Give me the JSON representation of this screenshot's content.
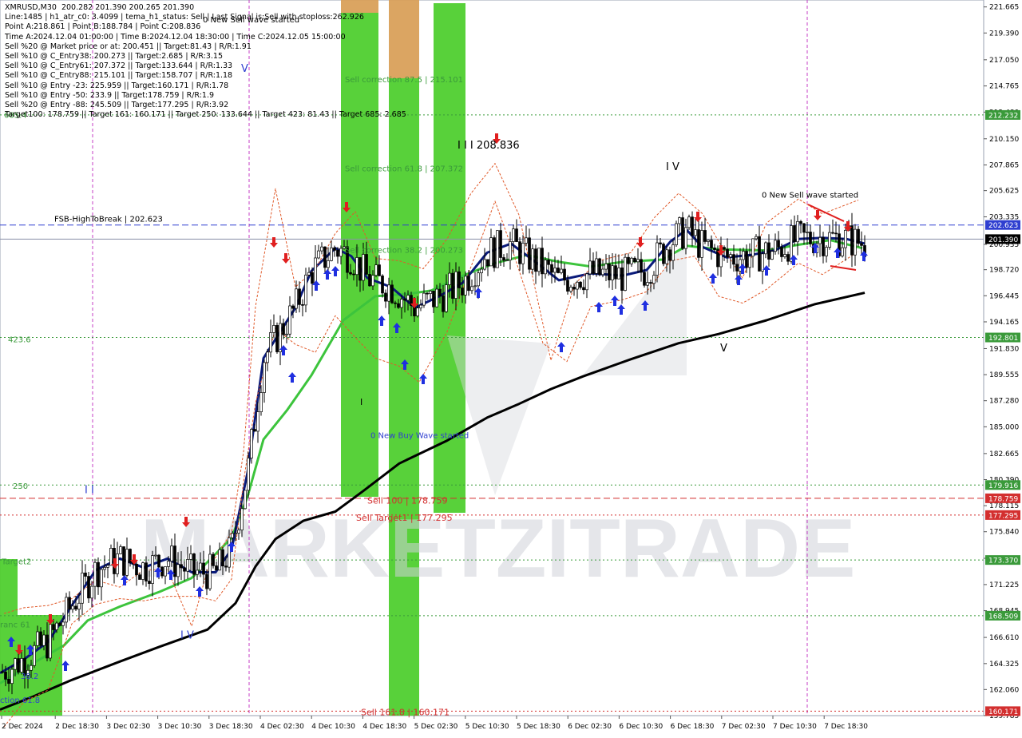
{
  "info_lines": [
    "XMRUSD,M30  200.282 201.390 200.265 201.390",
    "Line:1485 | h1_atr_c0: 3.4099 | tema_h1_status: Sell | Last Signal is:Sell with stoploss:262.926",
    "Point A:218.861 | Point B:188.784 | Point C:208.836",
    "Time A:2024.12.04 01:00:00 | Time B:2024.12.04 18:30:00 | Time C:2024.12.05 15:00:00",
    "Sell %20 @ Market price or at: 200.451 || Target:81.43 | R/R:1.91",
    "Sell %10 @ C_Entry38: 200.273 || Target:2.685 | R/R:3.15",
    "Sell %10 @ C_Entry61: 207.372 || Target:133.644 | R/R:1.33",
    "Sell %10 @ C_Entry88: 215.101 || Target:158.707 | R/R:1.18",
    "Sell %10 @ Entry -23: 225.959 || Target:160.171 | R/R:1.78",
    "Sell %10 @ Entry -50: 233.9 || Target:178.759 | R/R:1.9",
    "Sell %20 @ Entry -88: 245.509 || Target:177.295 | R/R:3.92",
    "Target100: 178.759 || Target 161: 160.171 || Target 250: 133.644 || Target 423: 81.43 || Target 685: 2.685"
  ],
  "watermark": "MARKETZITRADE",
  "chart_data": {
    "type": "candlestick",
    "symbol": "XMRUSD",
    "timeframe": "M30",
    "ylim": [
      159.78,
      222.27
    ],
    "y_ticks": [
      "221.665",
      "219.390",
      "217.050",
      "214.765",
      "212.480",
      "210.150",
      "207.865",
      "205.625",
      "203.335",
      "200.935",
      "198.720",
      "196.445",
      "194.165",
      "191.830",
      "189.555",
      "187.280",
      "185.000",
      "182.665",
      "180.390",
      "178.115",
      "175.840",
      "173.520",
      "171.225",
      "168.945",
      "166.610",
      "164.325",
      "162.060",
      "159.785"
    ],
    "x_ticks": [
      "2 Dec 2024",
      "2 Dec 18:30",
      "3 Dec 02:30",
      "3 Dec 10:30",
      "3 Dec 18:30",
      "4 Dec 02:30",
      "4 Dec 10:30",
      "4 Dec 18:30",
      "5 Dec 02:30",
      "5 Dec 10:30",
      "5 Dec 18:30",
      "6 Dec 02:30",
      "6 Dec 10:30",
      "6 Dec 18:30",
      "7 Dec 02:30",
      "7 Dec 10:30",
      "7 Dec 18:30"
    ],
    "price_labels": [
      {
        "value": 212.232,
        "text": "212.232",
        "color": "#3a9a3a"
      },
      {
        "value": 202.623,
        "text": "202.623",
        "color": "#2f3fd0"
      },
      {
        "value": 201.39,
        "text": "201.390",
        "color": "#000000"
      },
      {
        "value": 192.801,
        "text": "192.801",
        "color": "#3a9a3a"
      },
      {
        "value": 179.916,
        "text": "179.916",
        "color": "#3a9a3a"
      },
      {
        "value": 178.759,
        "text": "178.759",
        "color": "#d32f2f"
      },
      {
        "value": 177.295,
        "text": "177.295",
        "color": "#d32f2f"
      },
      {
        "value": 173.37,
        "text": "173.370",
        "color": "#3a9a3a"
      },
      {
        "value": 168.509,
        "text": "168.509",
        "color": "#3a9a3a"
      },
      {
        "value": 160.171,
        "text": "160.171",
        "color": "#d32f2f"
      }
    ],
    "h_lines": [
      {
        "value": 212.232,
        "color": "#3a9a3a",
        "style": "dotted"
      },
      {
        "value": 202.623,
        "color": "#2f3fd0",
        "style": "dashed"
      },
      {
        "value": 201.39,
        "color": "#8a8fa8",
        "style": "solid"
      },
      {
        "value": 192.801,
        "color": "#3a9a3a",
        "style": "dotted"
      },
      {
        "value": 179.916,
        "color": "#3a9a3a",
        "style": "dotted"
      },
      {
        "value": 178.759,
        "color": "#d32f2f",
        "style": "dashed"
      },
      {
        "value": 177.295,
        "color": "#d32f2f",
        "style": "dotted"
      },
      {
        "value": 173.37,
        "color": "#3a9a3a",
        "style": "dotted"
      },
      {
        "value": 168.509,
        "color": "#3a9a3a",
        "style": "dotted"
      },
      {
        "value": 160.171,
        "color": "#d32f2f",
        "style": "dotted"
      }
    ],
    "level_labels": [
      {
        "text": "685.4",
        "value": 212.0,
        "x": 5,
        "color": "#3a9a3a"
      },
      {
        "text": "423.6",
        "value": 192.4,
        "x": 10,
        "color": "#3a9a3a"
      },
      {
        "text": "250",
        "value": 179.6,
        "x": 16,
        "color": "#3a9a3a"
      },
      {
        "text": "Target2",
        "value": 173.0,
        "x": 2,
        "color": "#3a9a3a"
      },
      {
        "text": "FSB-HighToBreak | 202.623",
        "value": 202.9,
        "x": 68,
        "color": "#000000"
      }
    ],
    "annotations": [
      {
        "text": "0 New Sell wave started",
        "value": 220.3,
        "x": 254,
        "color": "#000000",
        "size": 10
      },
      {
        "text": "Sell correction 87.5 | 215.101",
        "value": 215.1,
        "x": 432,
        "color": "#3a9a3a",
        "size": 10
      },
      {
        "text": "Sell correction 61.8 | 207.372",
        "value": 207.3,
        "x": 432,
        "color": "#3a9a3a",
        "size": 10
      },
      {
        "text": "Sell correction 38.2 | 200.273",
        "value": 200.2,
        "x": 432,
        "color": "#3a9a3a",
        "size": 10
      },
      {
        "text": "I I I 208.836",
        "value": 209.3,
        "x": 573,
        "color": "#000000",
        "size": 13
      },
      {
        "text": "0 New Buy Wave started",
        "value": 184.0,
        "x": 464,
        "color": "#2f3fd0",
        "size": 10
      },
      {
        "text": "Sell 100 | 178.759",
        "value": 178.3,
        "x": 460,
        "color": "#d32f2f",
        "size": 11
      },
      {
        "text": "Sell Target1 | 177.295",
        "value": 176.8,
        "x": 446,
        "color": "#d32f2f",
        "size": 11
      },
      {
        "text": "Sell 161.8 | 160.171",
        "value": 159.8,
        "x": 452,
        "color": "#d32f2f",
        "size": 11
      },
      {
        "text": "0 New Sell wave started",
        "value": 205.0,
        "x": 954,
        "color": "#000000",
        "size": 10
      },
      {
        "text": "I V",
        "value": 207.4,
        "x": 834,
        "color": "#000000",
        "size": 13
      },
      {
        "text": "V",
        "value": 191.6,
        "x": 902,
        "color": "#000000",
        "size": 13
      },
      {
        "text": "V",
        "value": 216.0,
        "x": 302,
        "color": "#2f3fd0",
        "size": 13
      },
      {
        "text": "I I",
        "value": 179.2,
        "x": 106,
        "color": "#2f3fd0",
        "size": 13
      },
      {
        "text": "I V",
        "value": 166.5,
        "x": 226,
        "color": "#2f3fd0",
        "size": 13
      },
      {
        "text": "I",
        "value": 186.9,
        "x": 451,
        "color": "#000000",
        "size": 11
      },
      {
        "text": "38.2",
        "value": 163.0,
        "x": 26,
        "color": "#2f3fd0",
        "size": 10
      },
      {
        "text": "ction 61.8",
        "value": 160.9,
        "x": 0,
        "color": "#2f3fd0",
        "size": 10
      },
      {
        "text": "ranc 61",
        "value": 167.5,
        "x": 0,
        "color": "#3a9a3a",
        "size": 10
      }
    ],
    "series": [
      {
        "name": "",
        "color": "#000000",
        "width": 3,
        "points": [
          [
            0,
            160.3
          ],
          [
            40,
            161.4
          ],
          [
            90,
            162.9
          ],
          [
            150,
            164.5
          ],
          [
            200,
            165.8
          ],
          [
            260,
            167.3
          ],
          [
            295,
            169.6
          ],
          [
            320,
            172.8
          ],
          [
            345,
            175.2
          ],
          [
            380,
            176.8
          ],
          [
            420,
            177.6
          ],
          [
            455,
            179.4
          ],
          [
            500,
            181.8
          ],
          [
            560,
            183.8
          ],
          [
            610,
            185.8
          ],
          [
            650,
            187.0
          ],
          [
            690,
            188.3
          ],
          [
            730,
            189.4
          ],
          [
            790,
            190.9
          ],
          [
            850,
            192.3
          ],
          [
            900,
            193.1
          ],
          [
            960,
            194.3
          ],
          [
            1020,
            195.7
          ],
          [
            1083,
            196.7
          ]
        ]
      },
      {
        "name": "",
        "color": "#3cc43c",
        "width": 3,
        "points": [
          [
            0,
            162.6
          ],
          [
            40,
            164.3
          ],
          [
            80,
            165.9
          ],
          [
            110,
            168.1
          ],
          [
            150,
            169.3
          ],
          [
            200,
            170.6
          ],
          [
            240,
            171.8
          ],
          [
            290,
            175.3
          ],
          [
            310,
            178.9
          ],
          [
            330,
            183.9
          ],
          [
            360,
            186.5
          ],
          [
            390,
            189.5
          ],
          [
            430,
            194.3
          ],
          [
            470,
            196.4
          ],
          [
            510,
            196.6
          ],
          [
            540,
            196.9
          ],
          [
            580,
            198.2
          ],
          [
            620,
            199.3
          ],
          [
            660,
            200.0
          ],
          [
            700,
            199.4
          ],
          [
            740,
            199.0
          ],
          [
            780,
            199.4
          ],
          [
            830,
            199.6
          ],
          [
            860,
            200.8
          ],
          [
            900,
            200.5
          ],
          [
            960,
            200.4
          ],
          [
            1000,
            200.9
          ],
          [
            1040,
            201.3
          ],
          [
            1080,
            200.6
          ]
        ]
      },
      {
        "name": "",
        "color": "#0a1a7a",
        "width": 3,
        "points": [
          [
            0,
            163.5
          ],
          [
            30,
            164.7
          ],
          [
            60,
            166.2
          ],
          [
            90,
            169.4
          ],
          [
            120,
            172.5
          ],
          [
            150,
            173.5
          ],
          [
            180,
            172.7
          ],
          [
            210,
            173.5
          ],
          [
            240,
            172.3
          ],
          [
            270,
            172.3
          ],
          [
            290,
            174.3
          ],
          [
            310,
            181.0
          ],
          [
            330,
            191.0
          ],
          [
            350,
            193.2
          ],
          [
            370,
            195.4
          ],
          [
            390,
            198.6
          ],
          [
            420,
            200.6
          ],
          [
            440,
            199.9
          ],
          [
            460,
            198.0
          ],
          [
            490,
            197.2
          ],
          [
            520,
            195.4
          ],
          [
            550,
            196.4
          ],
          [
            580,
            197.6
          ],
          [
            610,
            200.2
          ],
          [
            640,
            201.0
          ],
          [
            680,
            198.9
          ],
          [
            700,
            197.8
          ],
          [
            740,
            198.4
          ],
          [
            780,
            198.2
          ],
          [
            810,
            198.7
          ],
          [
            840,
            201.2
          ],
          [
            860,
            202.2
          ],
          [
            880,
            200.7
          ],
          [
            910,
            199.8
          ],
          [
            940,
            200.0
          ],
          [
            970,
            200.4
          ],
          [
            1000,
            201.4
          ],
          [
            1030,
            201.5
          ],
          [
            1060,
            201.4
          ],
          [
            1083,
            201.0
          ]
        ]
      },
      {
        "name": "",
        "color": "#e05a2a",
        "width": 1,
        "dashed": true,
        "points": [
          [
            5,
            168.7
          ],
          [
            30,
            169.2
          ],
          [
            60,
            169.4
          ],
          [
            90,
            170.0
          ],
          [
            120,
            171.6
          ],
          [
            150,
            171.0
          ],
          [
            180,
            172.5
          ],
          [
            210,
            172.5
          ],
          [
            240,
            167.6
          ],
          [
            260,
            172.5
          ],
          [
            290,
            175.8
          ],
          [
            305,
            182.8
          ],
          [
            320,
            195.5
          ],
          [
            345,
            205.8
          ],
          [
            370,
            197.2
          ],
          [
            395,
            198.8
          ],
          [
            420,
            201.9
          ],
          [
            445,
            203.8
          ],
          [
            470,
            199.7
          ],
          [
            500,
            199.5
          ],
          [
            530,
            198.8
          ],
          [
            560,
            201.4
          ],
          [
            590,
            205.4
          ],
          [
            620,
            208.0
          ],
          [
            650,
            203.5
          ],
          [
            690,
            190.8
          ],
          [
            720,
            197.5
          ],
          [
            750,
            199.5
          ],
          [
            790,
            200.2
          ],
          [
            820,
            203.3
          ],
          [
            850,
            205.4
          ],
          [
            880,
            203.6
          ],
          [
            900,
            201.2
          ],
          [
            930,
            198.0
          ],
          [
            960,
            202.8
          ],
          [
            1000,
            204.9
          ],
          [
            1030,
            203.6
          ],
          [
            1075,
            204.8
          ]
        ]
      },
      {
        "name": "",
        "color": "#e05a2a",
        "width": 1,
        "dashed": true,
        "points": [
          [
            5,
            158.8
          ],
          [
            30,
            161.0
          ],
          [
            60,
            162.0
          ],
          [
            90,
            167.8
          ],
          [
            120,
            169.5
          ],
          [
            150,
            170.0
          ],
          [
            180,
            169.8
          ],
          [
            210,
            170.2
          ],
          [
            245,
            170.2
          ],
          [
            270,
            169.8
          ],
          [
            290,
            171.7
          ],
          [
            305,
            180.2
          ],
          [
            320,
            187.1
          ],
          [
            345,
            193.6
          ],
          [
            370,
            192.2
          ],
          [
            395,
            191.5
          ],
          [
            420,
            194.7
          ],
          [
            445,
            192.8
          ],
          [
            470,
            191.0
          ],
          [
            500,
            190.3
          ],
          [
            525,
            188.9
          ],
          [
            560,
            193.3
          ],
          [
            590,
            199.0
          ],
          [
            620,
            204.7
          ],
          [
            640,
            200.8
          ],
          [
            680,
            192.3
          ],
          [
            710,
            190.7
          ],
          [
            740,
            195.5
          ],
          [
            780,
            196.1
          ],
          [
            810,
            196.8
          ],
          [
            840,
            199.5
          ],
          [
            870,
            199.9
          ],
          [
            900,
            196.4
          ],
          [
            930,
            195.8
          ],
          [
            960,
            197.0
          ],
          [
            1000,
            199.3
          ],
          [
            1030,
            198.3
          ],
          [
            1075,
            200.3
          ]
        ]
      }
    ]
  }
}
